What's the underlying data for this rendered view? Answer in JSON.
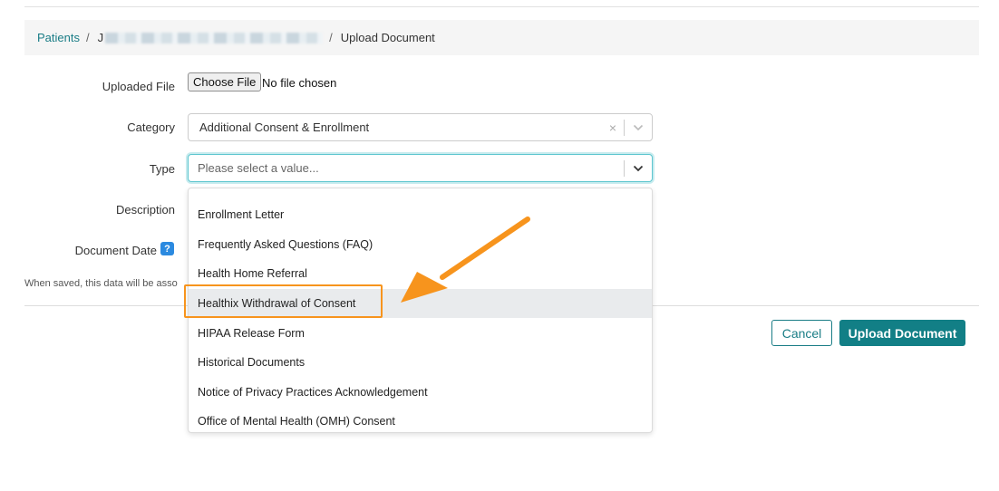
{
  "breadcrumb": {
    "root": "Patients",
    "patient_initial": "J",
    "current": "Upload Document",
    "separator": "/"
  },
  "form": {
    "uploaded_file_label": "Uploaded File",
    "choose_file_label": "Choose File",
    "file_status": "No file chosen",
    "category_label": "Category",
    "category_value": "Additional Consent & Enrollment",
    "type_label": "Type",
    "type_placeholder": "Please select a value...",
    "description_label": "Description",
    "document_date_label": "Document Date",
    "help_icon_glyph": "?",
    "clear_glyph": "×",
    "note": "When saved, this data will be asso"
  },
  "dropdown": {
    "options": [
      "Enrollment Letter",
      "Frequently Asked Questions (FAQ)",
      "Health Home Referral",
      "Healthix Withdrawal of Consent",
      "HIPAA Release Form",
      "Historical Documents",
      "Notice of Privacy Practices Acknowledgement",
      "Office of Mental Health (OMH) Consent"
    ],
    "highlighted_index": 3
  },
  "actions": {
    "cancel_label": "Cancel",
    "upload_label": "Upload Document"
  },
  "icons": {
    "category_clear": "close-icon",
    "category_chevron": "chevron-down-icon",
    "type_chevron": "chevron-down-icon",
    "help": "question-icon",
    "annotation": "arrow-icon"
  },
  "colors": {
    "accent": "#127f86",
    "link": "#1a7d86",
    "annotation": "#f7941d",
    "focus": "#5ec6cf",
    "help_badge": "#2b8ae0",
    "highlight_bg": "#e9ebed"
  }
}
